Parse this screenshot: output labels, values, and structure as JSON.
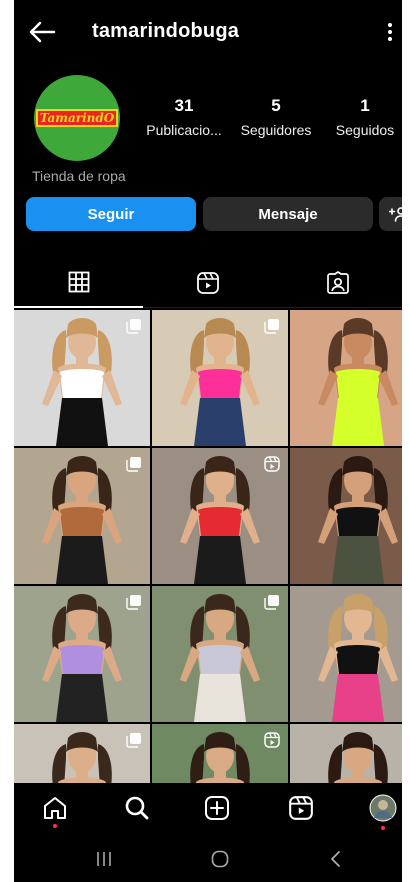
{
  "header": {
    "username": "tamarindobuga"
  },
  "profile": {
    "avatar_logo_text": "TamarindO",
    "category": "Tienda de ropa",
    "stats": [
      {
        "count": "31",
        "label": "Publicacio..."
      },
      {
        "count": "5",
        "label": "Seguidores"
      },
      {
        "count": "1",
        "label": "Seguidos"
      }
    ]
  },
  "actions": {
    "follow_label": "Seguir",
    "message_label": "Mensaje"
  },
  "tabs": [
    {
      "icon": "grid-icon",
      "active": true
    },
    {
      "icon": "reels-icon",
      "active": false
    },
    {
      "icon": "tagged-icon",
      "active": false
    }
  ],
  "posts": [
    {
      "badge": "multi",
      "bg": "#d9d9d9",
      "top": "#ffffff",
      "bottom": "#111111",
      "skin": "#e0b898",
      "hair": "#c99b62"
    },
    {
      "badge": "multi",
      "bg": "#d8cbb6",
      "top": "#ff2f9a",
      "bottom": "#2a3f6b",
      "skin": "#e2b48e",
      "hair": "#b78a52"
    },
    {
      "badge": "reel",
      "bg": "#d6a585",
      "top": "#d5ff2a",
      "bottom": "#d5ff2a",
      "skin": "#c98a62",
      "hair": "#5a3a26"
    },
    {
      "badge": "multi",
      "bg": "#b3a691",
      "top": "#b06a3b",
      "bottom": "#1b1b1b",
      "skin": "#d9a47e",
      "hair": "#3a2618"
    },
    {
      "badge": "reel",
      "bg": "#9a8f82",
      "top": "#e52b31",
      "bottom": "#1b1b1b",
      "skin": "#e0b08c",
      "hair": "#3a2618"
    },
    {
      "badge": "reel",
      "bg": "#7a5a48",
      "top": "#111111",
      "bottom": "#4c5240",
      "skin": "#d4a07a",
      "hair": "#2a1a12"
    },
    {
      "badge": "multi",
      "bg": "#9ea38e",
      "top": "#b18fe0",
      "bottom": "#222222",
      "skin": "#dcaa86",
      "hair": "#3e2a1c"
    },
    {
      "badge": "multi",
      "bg": "#7f8f70",
      "top": "#c8c8d8",
      "bottom": "#e8e4dc",
      "skin": "#d8a882",
      "hair": "#3b281c"
    },
    {
      "badge": "multi",
      "bg": "#a59a90",
      "top": "#111111",
      "bottom": "#e9408a",
      "skin": "#e3b792",
      "hair": "#c7a06a"
    },
    {
      "badge": "multi",
      "bg": "#c8c2b8",
      "top": "#8ab9b8",
      "bottom": "#8ab9b8",
      "skin": "#dcae8a",
      "hair": "#3b281c"
    },
    {
      "badge": "reel",
      "bg": "#6f8a62",
      "top": "#dfe9ee",
      "bottom": "#dfe9ee",
      "skin": "#d9aa86",
      "hair": "#2e1e14"
    },
    {
      "badge": "reel",
      "bg": "#b9b2a8",
      "top": "#111111",
      "bottom": "#111111",
      "skin": "#d8a882",
      "hair": "#2a1a12"
    }
  ],
  "navbar": [
    "home-icon",
    "search-icon",
    "create-icon",
    "reels-icon",
    "profile-avatar"
  ],
  "system_nav": [
    "recents-icon",
    "home-circle-icon",
    "back-chevron-icon"
  ]
}
